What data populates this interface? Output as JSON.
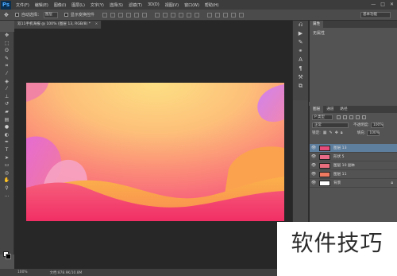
{
  "app": {
    "logo": "Ps"
  },
  "menu": [
    "文件(F)",
    "编辑(E)",
    "图像(I)",
    "图层(L)",
    "文字(Y)",
    "选择(S)",
    "滤镜(T)",
    "3D(D)",
    "视图(V)",
    "窗口(W)",
    "帮助(H)"
  ],
  "window_controls": [
    "—",
    "□",
    "✕"
  ],
  "options_bar": {
    "move_icon": "move-tool-icon",
    "auto_select_label": "自动选择：",
    "auto_select_value": "图层",
    "transform_label": "显示变换控件",
    "workspace": "基本功能"
  },
  "document": {
    "tab_title": "双11手机海报 @ 100% (图层 13, RGB/8) *",
    "zoom": "100%",
    "info": "文档:878.9K/10.8M"
  },
  "properties": {
    "tabs": [
      "属性"
    ],
    "body": "无属性"
  },
  "layers": {
    "tabs": [
      "图层",
      "通道",
      "路径"
    ],
    "filter": "P 类型",
    "blend_mode": "正常",
    "opacity_label": "不透明度:",
    "opacity": "100%",
    "lock_label": "锁定:",
    "fill_label": "填充:",
    "fill": "100%",
    "items": [
      {
        "name": "图层 13",
        "selected": true,
        "thumb": "#e54c7a",
        "locked": false
      },
      {
        "name": "形状 5",
        "selected": false,
        "thumb": "#e96a86",
        "locked": false
      },
      {
        "name": "图层 10 副本",
        "selected": false,
        "thumb": "#e86e7e",
        "locked": false
      },
      {
        "name": "图层 11",
        "selected": false,
        "thumb": "#f07a60",
        "locked": false
      },
      {
        "name": "背景",
        "selected": false,
        "thumb": "#ffffff",
        "locked": true
      }
    ]
  },
  "watermark": "软件技巧",
  "colors": {
    "canvas_top": "#fdd27c",
    "canvas_mid": "#fb8b73",
    "canvas_bottom": "#f23a6e",
    "wave_orange": "#f9a349",
    "blob_purple": "#d97de8",
    "selection_blue": "#5f7f9f"
  }
}
